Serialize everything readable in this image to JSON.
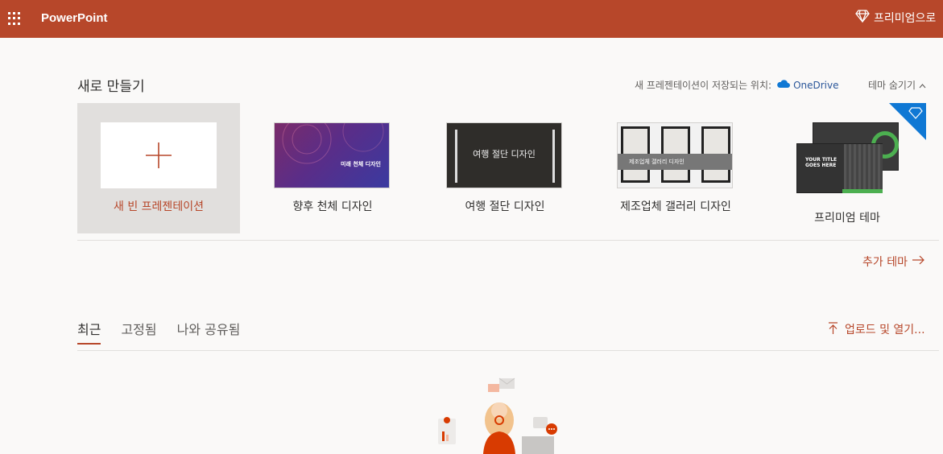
{
  "header": {
    "app_title": "PowerPoint",
    "premium_label": "프리미엄으로",
    "brand_color": "#b7472a"
  },
  "new_section": {
    "title": "새로 만들기",
    "save_location_label": "새 프레젠테이션이 저장되는 위치:",
    "save_location_service": "OneDrive",
    "hide_themes_label": "테마 숨기기",
    "tiles": [
      {
        "label": "새 빈 프레젠테이션"
      },
      {
        "label": "향후 천체 디자인",
        "thumb_text": "미래 천체 디자인"
      },
      {
        "label": "여행 절단 디자인",
        "thumb_text": "여행 절단 디자인"
      },
      {
        "label": "제조업체 갤러리 디자인",
        "thumb_text": "제조업체 갤러리 디자인"
      },
      {
        "label": "프리미엄 테마",
        "thumb_text": "YOUR TITLE GOES HERE"
      }
    ],
    "more_themes_label": "추가 테마"
  },
  "recent_section": {
    "tabs": [
      {
        "label": "최근",
        "active": true
      },
      {
        "label": "고정됨",
        "active": false
      },
      {
        "label": "나와 공유됨",
        "active": false
      }
    ],
    "upload_label": "업로드 및 열기..."
  }
}
